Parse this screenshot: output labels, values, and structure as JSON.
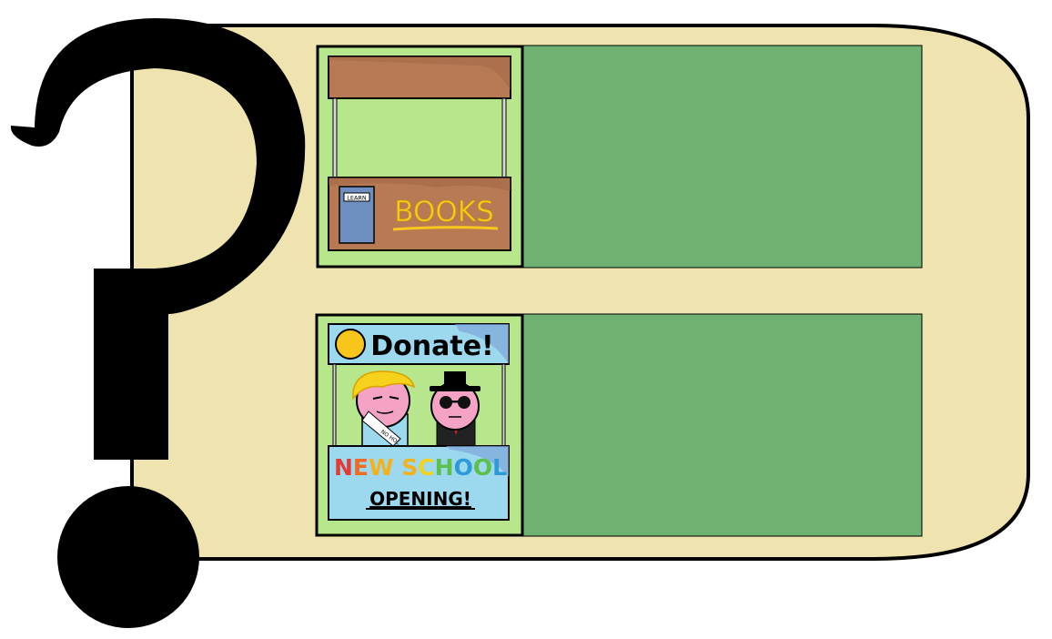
{
  "colors": {
    "panel": "#efe4b0",
    "outline": "#000000",
    "option_box": "#6fb173",
    "thumb_bg": "#b8e68c",
    "stall_wood": "#b77a55",
    "stall_wood_shadow": "#a06443",
    "sign_yellow": "#f7c81e",
    "donate_blue": "#9cd8ee",
    "donate_banner": "#dff2f8",
    "coin": "#f8c51b",
    "skin": "#f4a3c4"
  },
  "options": [
    {
      "name": "books-stall",
      "icon": "book-stall-icon",
      "sign": "BOOKS",
      "book_label": "LEARN"
    },
    {
      "name": "donate-stall",
      "icon": "donation-stall-icon",
      "header": "Donate!",
      "sign_line1_letters": [
        "N",
        "E",
        "W",
        " ",
        "S",
        "C",
        "H",
        "O",
        "O",
        "L"
      ],
      "sign_line1_colors": [
        "#e53935",
        "#f06a23",
        "#f3b21c",
        "#000000",
        "#f3b21c",
        "#f3d21c",
        "#5cc04a",
        "#2e9bd6",
        "#5cc04a",
        "#2e9bd6"
      ],
      "sign_line2": "OPENING!",
      "sash": "NO HOL"
    }
  ],
  "decor": {
    "question_mark_icon": "question-mark-icon"
  }
}
